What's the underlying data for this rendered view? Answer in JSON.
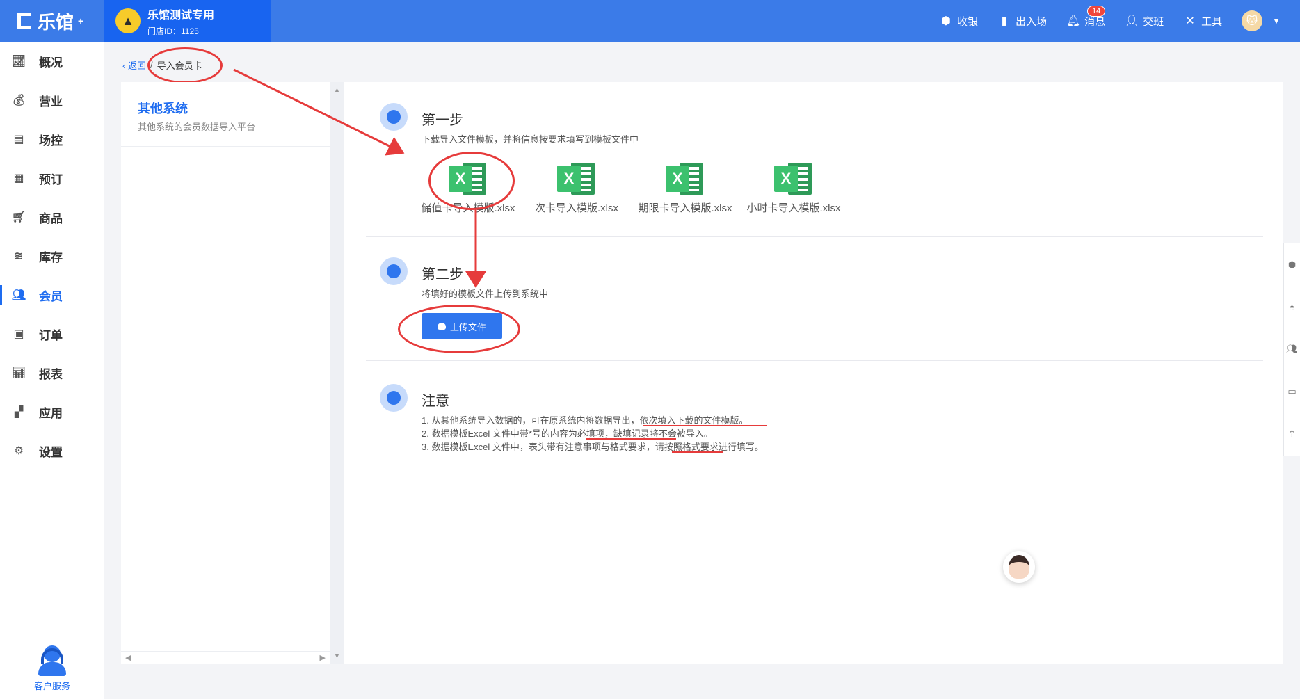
{
  "header": {
    "brand": "乐馆",
    "brand_sup": "+",
    "store_title": "乐馆测试专用",
    "store_id": "门店ID：1125",
    "actions": [
      {
        "label": "收银",
        "icon": "cashier-icon"
      },
      {
        "label": "出入场",
        "icon": "door-icon"
      },
      {
        "label": "消息",
        "icon": "bell-icon",
        "badge": "14"
      },
      {
        "label": "交班",
        "icon": "handover-icon"
      },
      {
        "label": "工具",
        "icon": "tools-icon"
      }
    ]
  },
  "sidebar": {
    "items": [
      {
        "label": "概况",
        "icon": "chart-icon"
      },
      {
        "label": "营业",
        "icon": "money-bag-icon"
      },
      {
        "label": "场控",
        "icon": "venue-icon"
      },
      {
        "label": "预订",
        "icon": "calendar-icon"
      },
      {
        "label": "商品",
        "icon": "cart-icon"
      },
      {
        "label": "库存",
        "icon": "layers-icon"
      },
      {
        "label": "会员",
        "icon": "member-icon",
        "active": true
      },
      {
        "label": "订单",
        "icon": "order-icon"
      },
      {
        "label": "报表",
        "icon": "report-icon"
      },
      {
        "label": "应用",
        "icon": "apps-icon"
      },
      {
        "label": "设置",
        "icon": "gear-icon"
      }
    ],
    "support_label": "客户服务"
  },
  "breadcrumb": {
    "back": "返回",
    "separator": "/",
    "current": "导入会员卡"
  },
  "left_panel": {
    "title": "其他系统",
    "desc": "其他系统的会员数据导入平台"
  },
  "steps": {
    "step1": {
      "title": "第一步",
      "desc": "下载导入文件模板，并将信息按要求填写到模板文件中",
      "files": [
        "储值卡导入模版.xlsx",
        "次卡导入模版.xlsx",
        "期限卡导入模版.xlsx",
        "小时卡导入模版.xlsx"
      ]
    },
    "step2": {
      "title": "第二步",
      "desc": "将填好的模板文件上传到系统中",
      "button": "上传文件"
    },
    "note": {
      "title": "注意",
      "lines": [
        "1. 从其他系统导入数据的，可在原系统内将数据导出，依次填入下载的文件模版。",
        "2. 数据模板Excel 文件中带*号的内容为必填项，缺填记录将不会被导入。",
        "3. 数据模板Excel 文件中，表头带有注意事项与格式要求，请按照格式要求进行填写。"
      ]
    }
  },
  "colors": {
    "primary": "#2f76ee",
    "header": "#3b7be8",
    "store_bg": "#1864f0",
    "annotation": "#e63b3b",
    "excel_green": "#3cc16e"
  }
}
